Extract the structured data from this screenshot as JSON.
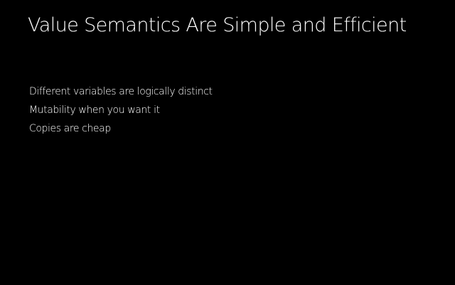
{
  "slide": {
    "title": "Value Semantics Are Simple and Efficient",
    "bullets": [
      "Different variables are logically distinct",
      "Mutability when you want it",
      "Copies are cheap"
    ]
  },
  "colors": {
    "background": "#000000",
    "text": "#ffffff"
  }
}
